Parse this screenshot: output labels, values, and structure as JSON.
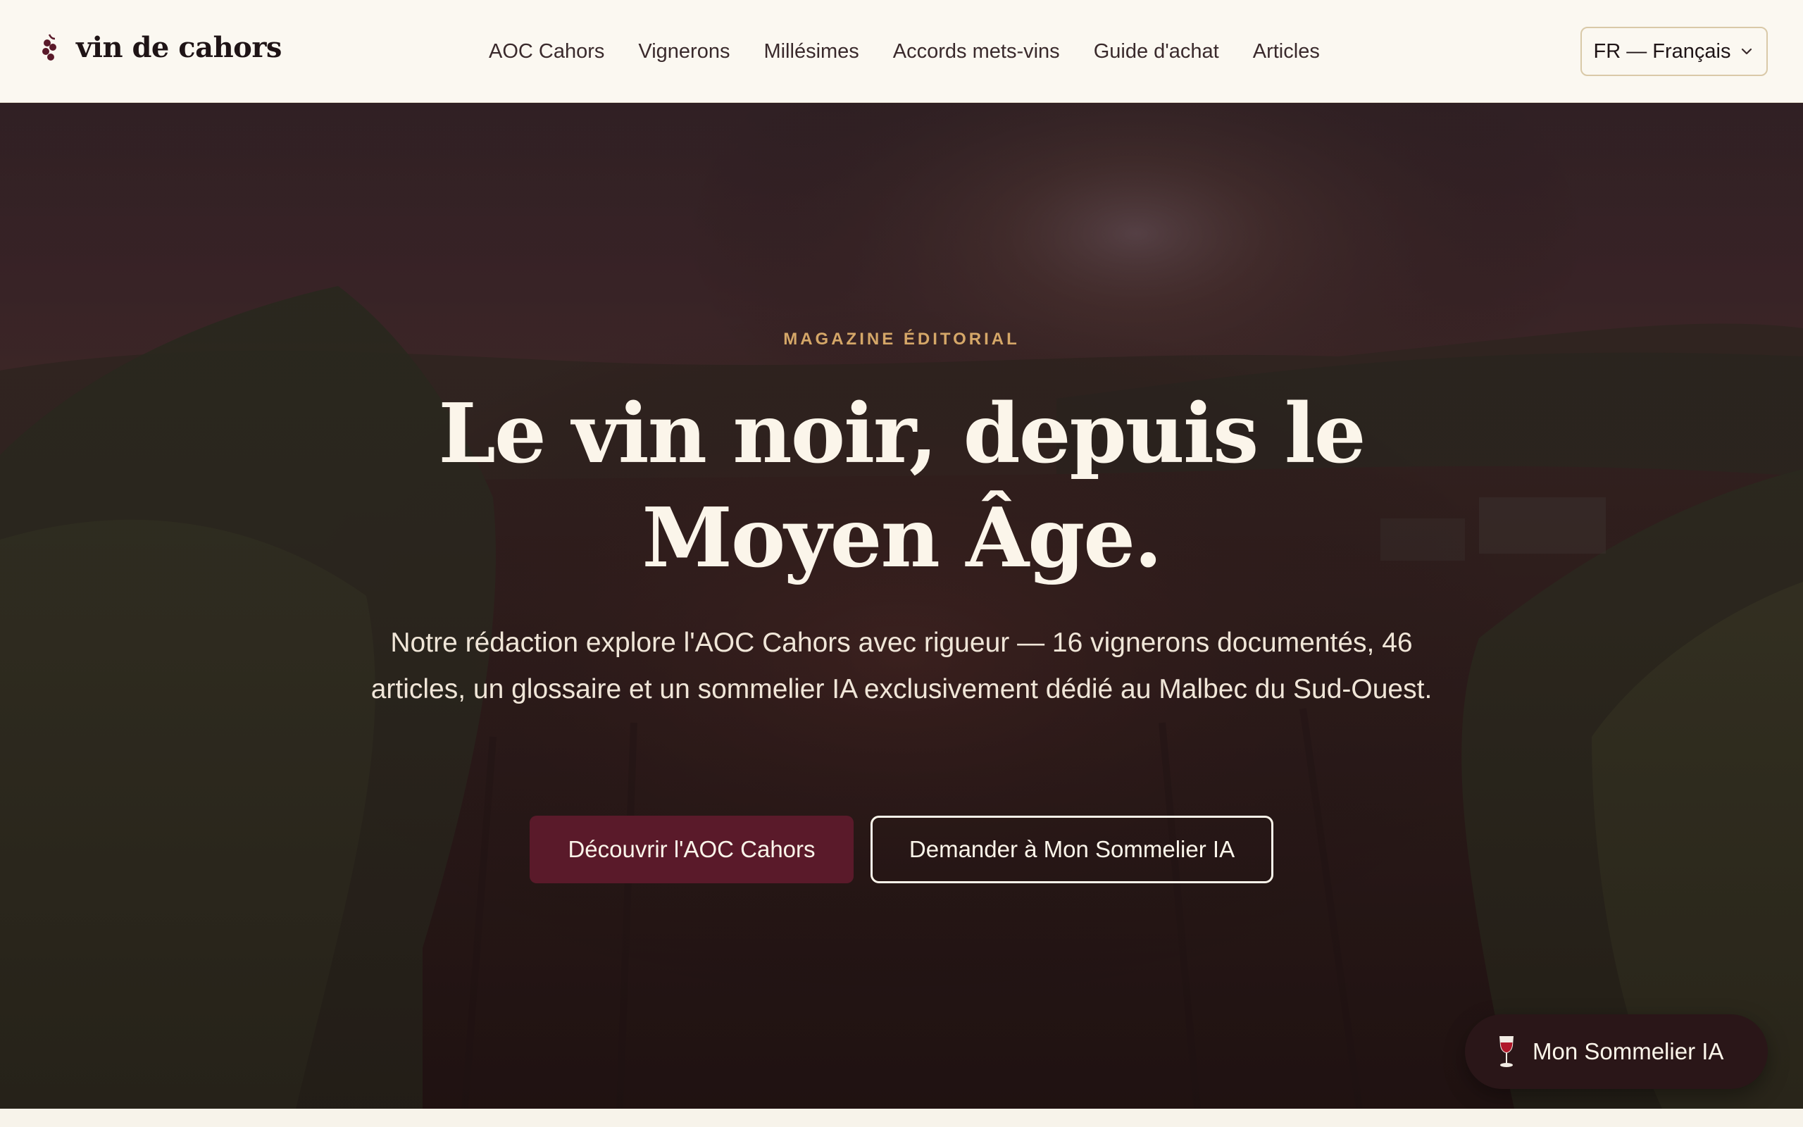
{
  "brand": {
    "name": "vin de cahors",
    "logo_icon": "grape-cluster-icon"
  },
  "nav": {
    "items": [
      {
        "label": "AOC Cahors"
      },
      {
        "label": "Vignerons"
      },
      {
        "label": "Millésimes"
      },
      {
        "label": "Accords mets-vins"
      },
      {
        "label": "Guide d'achat"
      },
      {
        "label": "Articles"
      }
    ]
  },
  "language": {
    "selected": "FR — Français",
    "icon": "chevron-down-icon"
  },
  "hero": {
    "eyebrow": "MAGAZINE ÉDITORIAL",
    "title": "Le vin noir, depuis le Moyen Âge.",
    "lead": "Notre rédaction explore l'AOC Cahors avec rigueur — 16 vignerons documentés, 46 articles, un glossaire et un sommelier IA exclusivement dédié au Malbec du Sud-Ouest.",
    "primary_cta": "Découvrir l'AOC Cahors",
    "secondary_cta": "Demander à Mon Sommelier IA"
  },
  "sommelier_widget": {
    "label": "Mon Sommelier IA",
    "icon": "wine-glass-icon"
  },
  "colors": {
    "accent": "#5a1a2a",
    "eyebrow": "#d5a768",
    "header_bg": "#fbf8f1",
    "hero_text": "#fbf5ea"
  }
}
